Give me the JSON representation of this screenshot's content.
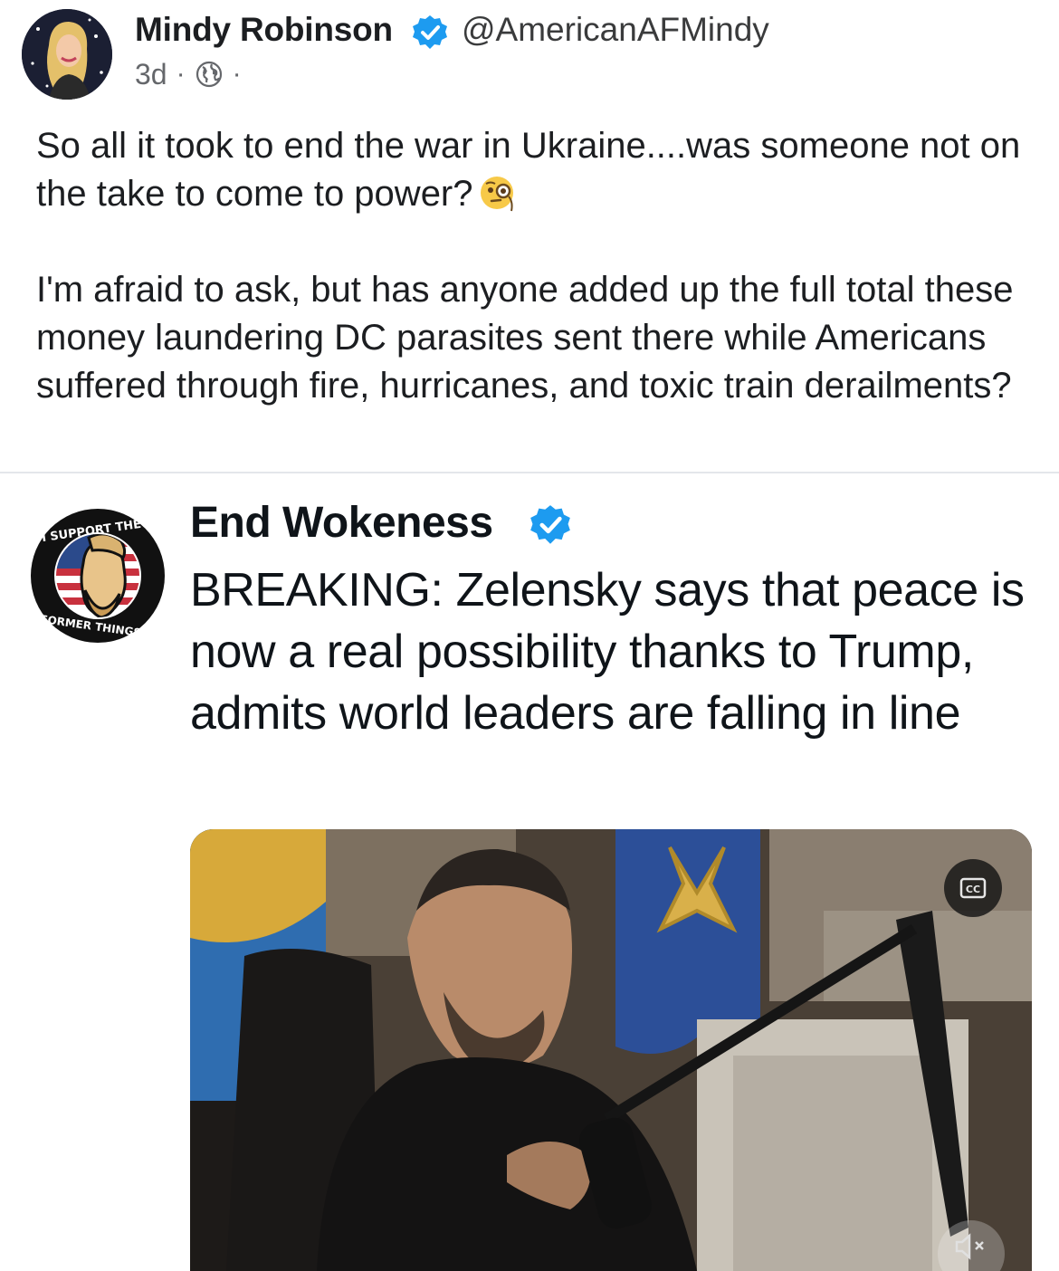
{
  "post": {
    "author": {
      "name": "Mindy Robinson",
      "handle": "@AmericanAFMindy",
      "verified": true
    },
    "meta": {
      "time": "3d",
      "separator": "·",
      "audience_icon": "globe-icon"
    },
    "text": {
      "line1": "So all it took to end the war in Ukraine....was someone not on the take to come to power?",
      "emoji": "face-with-monocle",
      "line2": "I'm afraid to ask, but has anyone added up the full total these money laundering DC parasites sent there while Americans suffered through fire, hurricanes, and toxic train derailments?"
    }
  },
  "embed": {
    "author": {
      "name": "End Wokeness",
      "verified": true
    },
    "text": "BREAKING: Zelensky says that peace is now a real possibility thanks to Trump, admits world leaders are falling in line",
    "video": {
      "captions_icon": "cc-icon",
      "mute_icon": "speaker-muted-icon"
    }
  },
  "colors": {
    "verified_blue": "#1d9bf0",
    "meta_gray": "#65676b",
    "divider": "#e4e6eb"
  }
}
